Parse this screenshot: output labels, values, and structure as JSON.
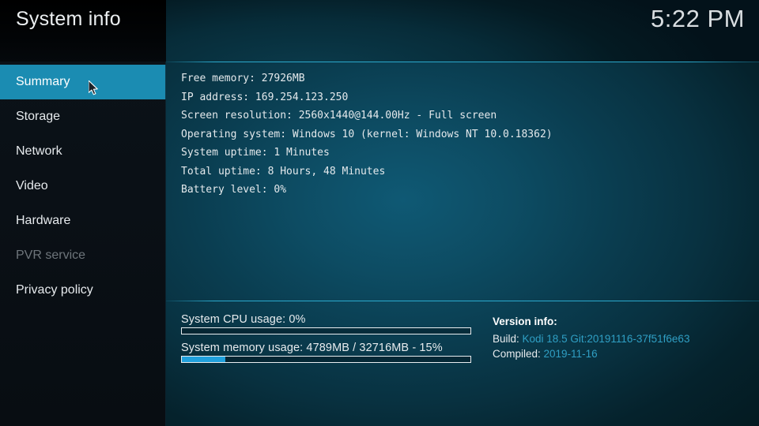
{
  "header": {
    "title": "System info",
    "clock": "5:22 PM"
  },
  "sidebar": {
    "items": [
      {
        "label": "Summary",
        "selected": true,
        "disabled": false
      },
      {
        "label": "Storage",
        "selected": false,
        "disabled": false
      },
      {
        "label": "Network",
        "selected": false,
        "disabled": false
      },
      {
        "label": "Video",
        "selected": false,
        "disabled": false
      },
      {
        "label": "Hardware",
        "selected": false,
        "disabled": false
      },
      {
        "label": "PVR service",
        "selected": false,
        "disabled": true
      },
      {
        "label": "Privacy policy",
        "selected": false,
        "disabled": false
      }
    ]
  },
  "main": {
    "info_lines": [
      "Free memory: 27926MB",
      "IP address: 169.254.123.250",
      "Screen resolution: 2560x1440@144.00Hz - Full screen",
      "Operating system: Windows 10 (kernel: Windows NT 10.0.18362)",
      "System uptime: 1 Minutes",
      "Total uptime: 8 Hours, 48 Minutes",
      "Battery level: 0%"
    ]
  },
  "status": {
    "cpu": {
      "label": "System CPU usage: 0%",
      "percent": 0
    },
    "memory": {
      "label": "System memory usage: 4789MB / 32716MB - 15%",
      "percent": 15
    }
  },
  "version": {
    "title": "Version info:",
    "build_label": "Build:",
    "build_value": "Kodi 18.5 Git:20191116-37f51f6e63",
    "compiled_label": "Compiled:",
    "compiled_value": "2019-11-16"
  },
  "colors": {
    "accent": "#1b8cb2",
    "progress_fill": "#20a0dc",
    "divider": "#2dafd4",
    "link_text": "#2f9fc4",
    "disabled_text": "#6e757b"
  }
}
